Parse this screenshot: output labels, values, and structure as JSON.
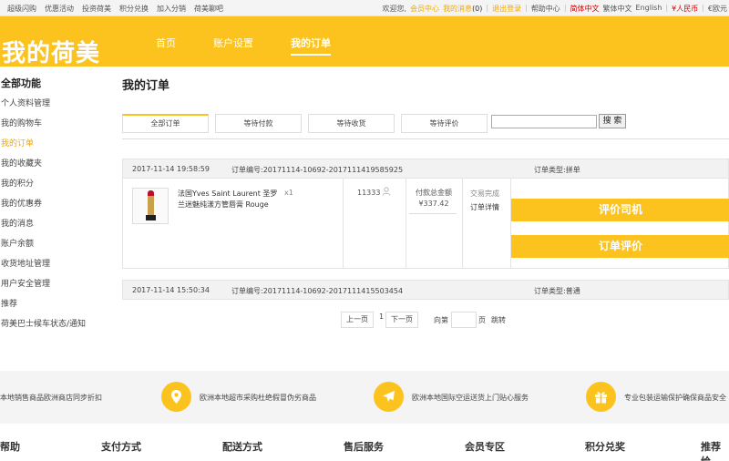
{
  "topbar": {
    "left_links": [
      "超级闪购",
      "优惠活动",
      "投资荷美",
      "积分兑换",
      "加入分销",
      "荷美聊吧"
    ],
    "welcome": "欢迎您,",
    "member_center": "会员中心",
    "my_messages": "我的消息",
    "message_count": "(0)",
    "logout": "退出登录",
    "help_center": "帮助中心",
    "lang_simplified": "简体中文",
    "lang_traditional": "繁体中文",
    "lang_english": "English",
    "currency_rmb": "¥人民币",
    "currency_eur": "€欧元"
  },
  "header": {
    "logo": "我的荷美",
    "nav": [
      "首页",
      "账户设置",
      "我的订单"
    ]
  },
  "sidebar": {
    "title": "全部功能",
    "items": [
      "个人资料管理",
      "我的购物车",
      "我的订单",
      "我的收藏夹",
      "我的积分",
      "我的优惠券",
      "我的消息",
      "账户余额",
      "收货地址管理",
      "用户安全管理",
      "推荐",
      "荷美巴士候车状态/通知"
    ]
  },
  "main": {
    "title": "我的订单",
    "tabs": [
      "全部订单",
      "等待付款",
      "等待收货",
      "等待评价"
    ],
    "search_button": "搜 索"
  },
  "orders": [
    {
      "time": "2017-11-14 19:58:59",
      "number": "订单编号:20171114-10692-2017111419585925",
      "type": "订单类型:拼单",
      "product_name": "法国Yves Saint Laurent 圣罗兰迷魅纯漾方管唇膏 Rouge",
      "qty": "x1",
      "user": "11333",
      "pay_label": "付款总金额",
      "amount": "¥337.42",
      "status": "交易完成",
      "detail": "订单详情",
      "btn1": "评价司机",
      "btn2": "订单评价"
    },
    {
      "time": "2017-11-14 15:50:34",
      "number": "订单编号:20171114-10692-2017111415503454",
      "type": "订单类型:普通"
    }
  ],
  "pager": {
    "prev": "上一页",
    "current": "1",
    "next": "下一页",
    "goto": "向第",
    "page_unit": "页",
    "jump": "跳转"
  },
  "features": [
    "本地销售商品欧洲商店同步折扣",
    "欧洲本地超市采购杜绝假冒伪劣商品",
    "欧洲本地国际空运送货上门贴心服务",
    "专业包装运输保护确保商品安全"
  ],
  "footer": {
    "headings": [
      "帮助",
      "支付方式",
      "配送方式",
      "售后服务",
      "会员专区",
      "积分兑奖",
      "推荐给"
    ]
  },
  "colors": {
    "brand": "#fcc31f",
    "active_text": "#f2a900",
    "red": "#d40000"
  }
}
